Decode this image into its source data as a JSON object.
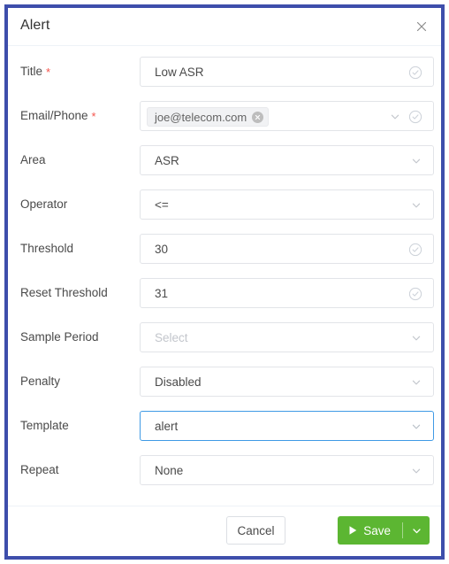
{
  "dialog": {
    "title": "Alert",
    "close_icon": "close-icon"
  },
  "form": {
    "rows": [
      {
        "label": "Title",
        "required": true,
        "type": "text",
        "value": "Low ASR",
        "placeholder": "",
        "focused": false,
        "icons": [
          "check-circle-icon"
        ]
      },
      {
        "label": "Email/Phone",
        "required": true,
        "type": "tags",
        "value": "",
        "placeholder": "",
        "focused": false,
        "chip": {
          "label": "joe@telecom.com",
          "remove_icon": "close-circle-icon"
        },
        "icons": [
          "chevron-down-icon",
          "check-circle-icon"
        ]
      },
      {
        "label": "Area",
        "required": false,
        "type": "select",
        "value": "ASR",
        "placeholder": "",
        "focused": false,
        "icons": [
          "chevron-down-icon"
        ]
      },
      {
        "label": "Operator",
        "required": false,
        "type": "select",
        "value": "<=",
        "placeholder": "",
        "focused": false,
        "icons": [
          "chevron-down-icon"
        ]
      },
      {
        "label": "Threshold",
        "required": false,
        "type": "text",
        "value": "30",
        "placeholder": "",
        "focused": false,
        "icons": [
          "check-circle-icon"
        ]
      },
      {
        "label": "Reset Threshold",
        "required": false,
        "type": "text",
        "value": "31",
        "placeholder": "",
        "focused": false,
        "icons": [
          "check-circle-icon"
        ]
      },
      {
        "label": "Sample Period",
        "required": false,
        "type": "select",
        "value": "",
        "placeholder": "Select",
        "focused": false,
        "icons": [
          "chevron-down-icon"
        ]
      },
      {
        "label": "Penalty",
        "required": false,
        "type": "select",
        "value": "Disabled",
        "placeholder": "",
        "focused": false,
        "icons": [
          "chevron-down-icon"
        ]
      },
      {
        "label": "Template",
        "required": false,
        "type": "select",
        "value": "alert",
        "placeholder": "",
        "focused": true,
        "icons": [
          "chevron-down-icon"
        ]
      },
      {
        "label": "Repeat",
        "required": false,
        "type": "select",
        "value": "None",
        "placeholder": "",
        "focused": false,
        "icons": [
          "chevron-down-icon"
        ]
      }
    ]
  },
  "footer": {
    "cancel_label": "Cancel",
    "save_label": "Save",
    "save_icon": "play-icon",
    "save_dropdown_icon": "chevron-down-icon"
  },
  "colors": {
    "dialog_border": "#3e4eab",
    "save_green": "#5cb632",
    "focus_blue": "#3f9ae5",
    "required_red": "#f5544c",
    "field_border": "#e2e4e8",
    "placeholder": "#c3c6cc"
  }
}
